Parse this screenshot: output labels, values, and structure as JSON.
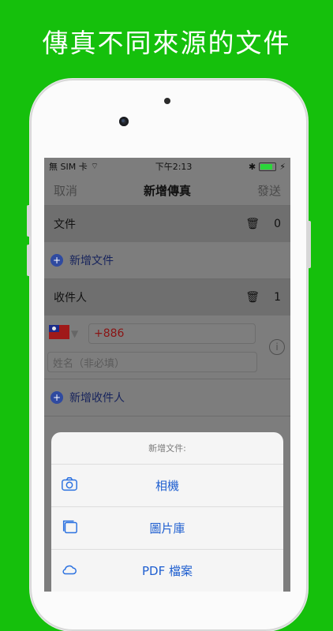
{
  "headline": "傳真不同來源的文件",
  "status": {
    "carrier": "無 SIM 卡",
    "time": "下午2:13"
  },
  "nav": {
    "cancel": "取消",
    "title": "新增傳真",
    "send": "發送"
  },
  "files_section": {
    "label": "文件",
    "count": "0"
  },
  "add_file": {
    "label": "新增文件"
  },
  "recipients_section": {
    "label": "收件人",
    "count": "1"
  },
  "recipient": {
    "country_code": "+886",
    "name_placeholder": "姓名（非必填）"
  },
  "add_recipient": {
    "label": "新增收件人"
  },
  "action_sheet": {
    "title": "新增文件:",
    "items": [
      {
        "label": "相機",
        "icon": "camera-icon"
      },
      {
        "label": "圖片庫",
        "icon": "photo-library-icon"
      },
      {
        "label": "PDF 檔案",
        "icon": "cloud-icon"
      }
    ]
  }
}
